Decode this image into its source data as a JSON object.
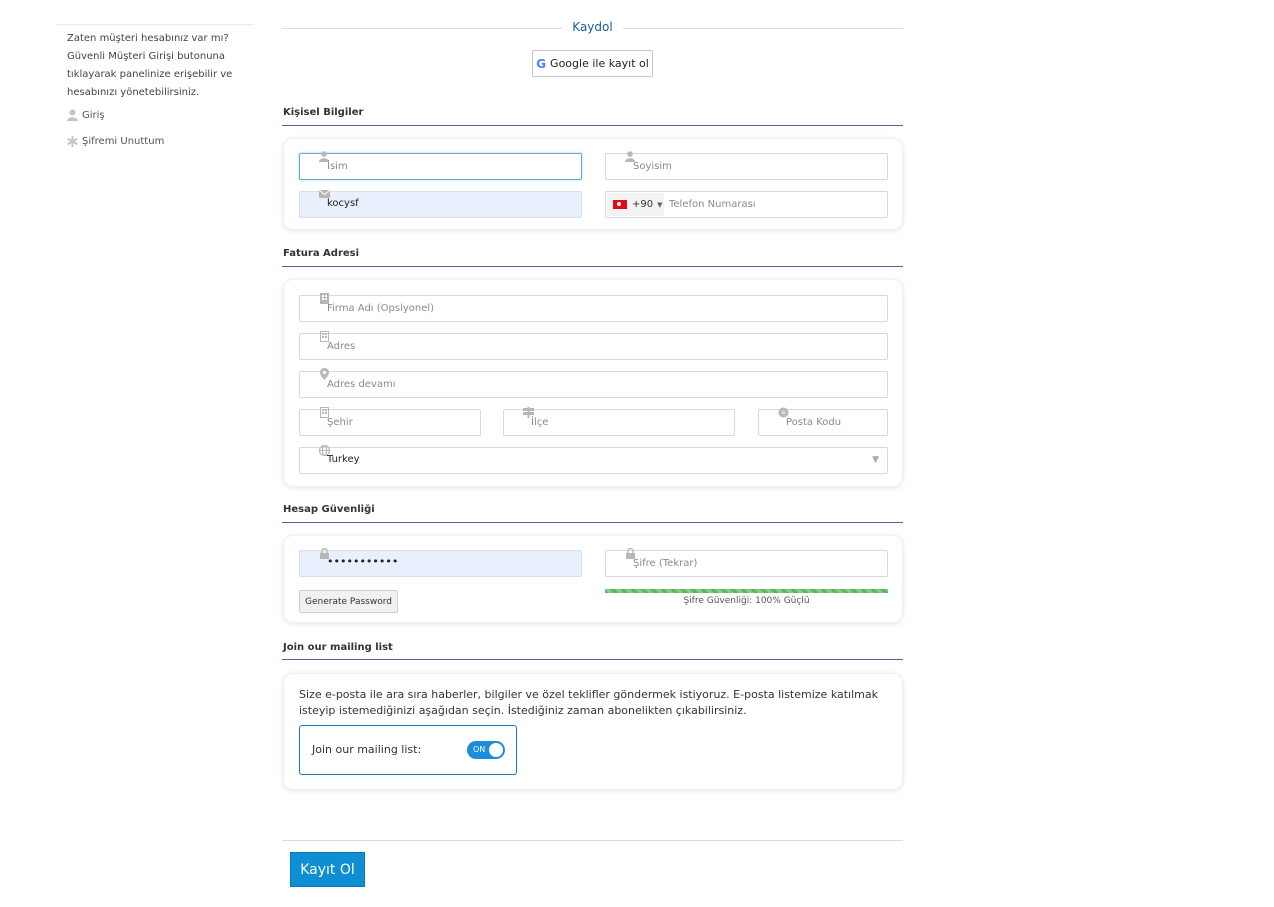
{
  "sidebar": {
    "info_text": "Zaten müşteri hesabınız var mı? Güvenli Müşteri Girişi butonuna tıklayarak panelinize erişebilir ve hesabınızı yönetebilirsiniz.",
    "login_label": "Giriş",
    "forgot_label": "Şifremi Unuttum"
  },
  "header": {
    "title": "Kaydol",
    "google_label": "Google ile kayıt ol"
  },
  "personal": {
    "title": "Kişisel Bilgiler",
    "first_name_placeholder": "İsim",
    "last_name_placeholder": "Soyisim",
    "email_value": "kocysf",
    "phone_code": "+90",
    "phone_placeholder": "Telefon Numarası"
  },
  "billing": {
    "title": "Fatura Adresi",
    "company_placeholder": "Firma Adı (Opsiyonel)",
    "address_placeholder": "Adres",
    "address2_placeholder": "Adres devamı",
    "city_placeholder": "Şehir",
    "district_placeholder": "İlçe",
    "postcode_placeholder": "Posta Kodu",
    "country_value": "Turkey"
  },
  "security": {
    "title": "Hesap Güvenliği",
    "password_value": "•••••••••••",
    "password_confirm_placeholder": "Şifre (Tekrar)",
    "generate_label": "Generate Password",
    "strength_text": "Şifre Güvenliği: 100% Güçlü",
    "strength_percent": 100
  },
  "mailing": {
    "title": "Join our mailing list",
    "description": "Size e-posta ile ara sıra haberler, bilgiler ve özel teklifler göndermek istiyoruz. E-posta listemize katılmak isteyip istemediğinizi aşağıdan seçin. İstediğiniz zaman abonelikten çıkabilirsiniz.",
    "toggle_label": "Join our mailing list:",
    "toggle_state": "ON"
  },
  "submit_label": "Kayıt Ol",
  "colors": {
    "accent": "#0e8fd3",
    "section_line": "#5b5f9e",
    "strength": "#5cb85c"
  }
}
